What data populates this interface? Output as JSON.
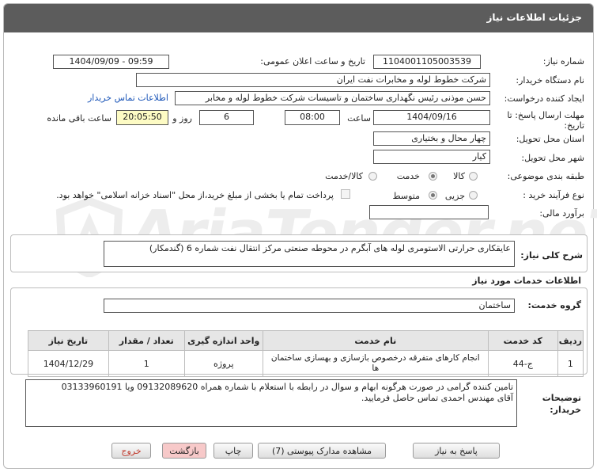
{
  "header": {
    "title": "جزئیات اطلاعات نیاز"
  },
  "form": {
    "need_number_label": "شماره نیاز:",
    "need_number": "1104001105003539",
    "announce_label": "تاریخ و ساعت اعلان عمومی:",
    "announce_value": "1404/09/09 - 09:59",
    "buyer_label": "نام دستگاه خریدار:",
    "buyer_value": "شرکت خطوط لوله و مخابرات نفت ایران",
    "creator_label": "ایجاد کننده درخواست:",
    "creator_value": "حسن  موذنی  رئیس نگهداری ساختمان و تاسیسات  شرکت خطوط لوله و مخابر",
    "contact_link": "اطلاعات تماس خریدار",
    "deadline_label_1": "مهلت ارسال پاسخ: تا",
    "deadline_label_2": "تاریخ:",
    "deadline_date": "1404/09/16",
    "time_label": "ساعت",
    "deadline_time": "08:00",
    "days_value": "6",
    "days_label": "روز و",
    "remaining_value": "20:05:50",
    "remaining_label": "ساعت باقی مانده",
    "province_label": "استان محل تحویل:",
    "province_value": "چهار محال و بختیاری",
    "city_label": "شهر محل تحویل:",
    "city_value": "کیار",
    "category_label": "طبقه بندی موضوعی:",
    "category_options": [
      "کالا",
      "خدمت",
      "کالا/خدمت"
    ],
    "category_selected": "خدمت",
    "process_label": "نوع فرآیند خرید :",
    "process_options": [
      "جزیی",
      "متوسط"
    ],
    "process_selected": "متوسط",
    "payment_note": "پرداخت تمام یا بخشی از مبلغ خرید،از محل \"اسناد خزانه اسلامی\" خواهد بود.",
    "estimate_label": "برآورد مالی:",
    "estimate_value": ""
  },
  "description": {
    "label": "شرح کلی نیاز:",
    "value": "عایقکاری حرارتی الاستومری لوله های آبگرم در محوطه صنعتی مرکز انتقال نفت شماره 6 (گندمکار)"
  },
  "services": {
    "section_title": "اطلاعات خدمات مورد نیاز",
    "group_label": "گروه خدمت:",
    "group_value": "ساختمان",
    "columns": [
      "ردیف",
      "کد خدمت",
      "نام خدمت",
      "واحد اندازه گیری",
      "تعداد / مقدار",
      "تاریخ نیاز"
    ],
    "rows": [
      [
        "1",
        "ج-44",
        "انجام کارهای متفرقه درخصوص بازسازی و بهسازی ساختمان ها",
        "پروژه",
        "1",
        "1404/12/29"
      ]
    ]
  },
  "notes": {
    "label_1": "توضیحات",
    "label_2": "خریدار:",
    "value_line1": "تامین کننده گرامی در صورت هرگونه ابهام و سوال در رابطه با استعلام  با شماره همراه 09132089620 ویا 03133960191",
    "value_line2": "آقای مهندس احمدی تماس حاصل فرمایید."
  },
  "buttons": {
    "reply": "پاسخ به نیاز",
    "attachments": "مشاهده مدارک پیوستی (7)",
    "print": "چاپ",
    "back": "بازگشت",
    "exit": "خروج"
  },
  "watermark": "AriaTender.neT",
  "colors": {
    "header_bg": "#5c5c5c",
    "link": "#1c56b8",
    "yellow_field": "#fdfbc4",
    "exit_text": "#c0392b"
  }
}
